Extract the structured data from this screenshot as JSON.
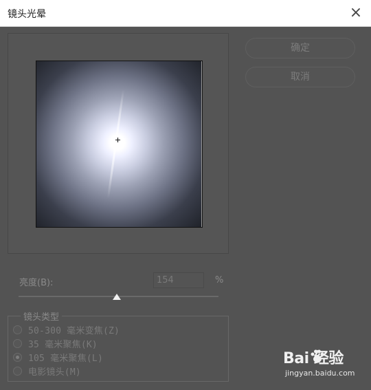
{
  "window": {
    "title": "镜头光晕",
    "close_glyph": "×"
  },
  "buttons": {
    "ok": "确定",
    "cancel": "取消"
  },
  "brightness": {
    "label": "亮度(B):",
    "value": "154",
    "unit": "%",
    "slider_fraction": 0.49
  },
  "lens_type": {
    "legend": "镜头类型",
    "options": [
      {
        "label": "50-300 毫米变焦(Z)",
        "checked": false
      },
      {
        "label": "35 毫米聚焦(K)",
        "checked": false
      },
      {
        "label": "105 毫米聚焦(L)",
        "checked": true
      },
      {
        "label": "电影镜头(M)",
        "checked": false
      }
    ]
  },
  "watermark": {
    "brand": "Bai  经验",
    "url": "jingyan.baidu.com"
  },
  "icons": {
    "close": "close-icon",
    "crosshair": "crosshair-icon",
    "paw": "baidu-paw-icon"
  }
}
